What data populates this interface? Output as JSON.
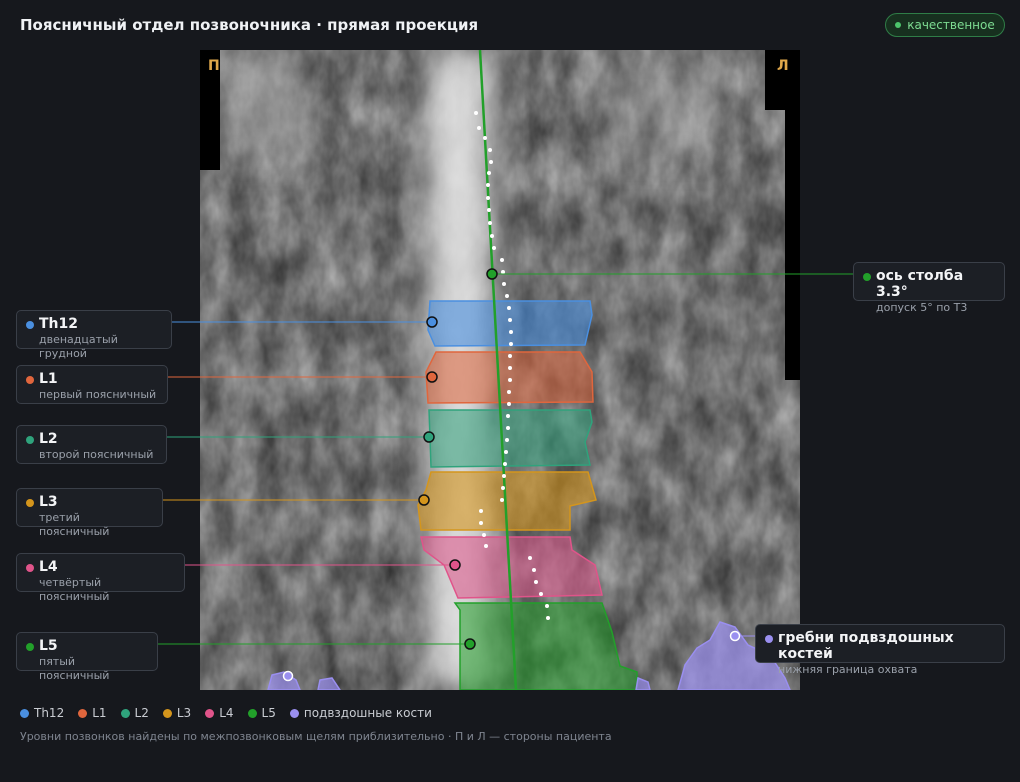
{
  "header": {
    "title": "Поясничный отдел позвоночника · прямая проекция",
    "quality_badge": "качественное"
  },
  "image": {
    "side_left": "П",
    "side_right": "Л"
  },
  "vertebrae": [
    {
      "id": "Th12",
      "label": "Th12",
      "description": "двенадцатый грудной",
      "color": "#4a8fe0"
    },
    {
      "id": "L1",
      "label": "L1",
      "description": "первый поясничный",
      "color": "#e0663d"
    },
    {
      "id": "L2",
      "label": "L2",
      "description": "второй поясничный",
      "color": "#2fa37c"
    },
    {
      "id": "L3",
      "label": "L3",
      "description": "третий поясничный",
      "color": "#d4951c"
    },
    {
      "id": "L4",
      "label": "L4",
      "description": "четвёртый поясничный",
      "color": "#e0548a"
    },
    {
      "id": "L5",
      "label": "L5",
      "description": "пятый поясничный",
      "color": "#22a02a"
    }
  ],
  "axis": {
    "label": "ось столба 3.3°",
    "description": "допуск 5° по Т3",
    "color": "#22a02a"
  },
  "iliac": {
    "label": "гребни подвздошных костей",
    "description": "нижняя граница охвата",
    "color": "#9a8ff0"
  },
  "legend": {
    "items": [
      {
        "label": "Th12",
        "color": "#4a8fe0"
      },
      {
        "label": "L1",
        "color": "#e0663d"
      },
      {
        "label": "L2",
        "color": "#2fa37c"
      },
      {
        "label": "L3",
        "color": "#d4951c"
      },
      {
        "label": "L4",
        "color": "#e0548a"
      },
      {
        "label": "L5",
        "color": "#22a02a"
      },
      {
        "label": "подвздошные кости",
        "color": "#9a8ff0"
      }
    ]
  },
  "footnote": "Уровни позвонков найдены по межпозвонковым щелям приблизительно · П и Л — стороны пациента"
}
